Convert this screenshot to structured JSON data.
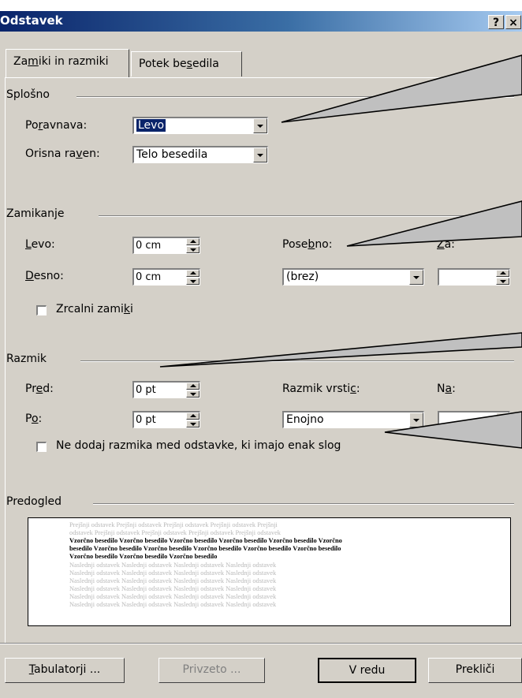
{
  "window": {
    "title": "Odstavek",
    "help_glyph": "?",
    "close_glyph": "×"
  },
  "tabs": [
    {
      "label_pre": "Za",
      "label_acc": "m",
      "label_post": "iki in razmiki",
      "active": true
    },
    {
      "label_pre": "Potek be",
      "label_acc": "s",
      "label_post": "edila",
      "active": false
    }
  ],
  "general": {
    "group": "Splošno",
    "alignment": {
      "pre": "Po",
      "acc": "r",
      "post": "avnava:",
      "value": "Levo"
    },
    "outline": {
      "pre": "Orisna ra",
      "acc": "v",
      "post": "en:",
      "value": "Telo besedila"
    }
  },
  "indent": {
    "group": "Zamikanje",
    "left": {
      "pre": "",
      "acc": "L",
      "post": "evo:",
      "value": "0 cm"
    },
    "right": {
      "pre": "",
      "acc": "D",
      "post": "esno:",
      "value": "0 cm"
    },
    "special": {
      "pre": "Pose",
      "acc": "b",
      "post": "no:",
      "value": "(brez)"
    },
    "by": {
      "pre": "",
      "acc": "Z",
      "post": "a:",
      "value": ""
    },
    "mirror": {
      "pre": "Zrcalni zami",
      "acc": "k",
      "post": "i",
      "checked": false
    }
  },
  "spacing": {
    "group": "Razmik",
    "before": {
      "pre": "Pr",
      "acc": "e",
      "post": "d:",
      "value": "0 pt"
    },
    "after": {
      "pre": "P",
      "acc": "o",
      "post": ":",
      "value": "0 pt"
    },
    "line": {
      "pre": "Razmik vrsti",
      "acc": "c",
      "post": ":",
      "value": "Enojno"
    },
    "at": {
      "pre": "N",
      "acc": "a",
      "post": ":",
      "value": ""
    },
    "no_space": {
      "pre": "Ne doda",
      "acc": "j",
      "post": " razmika med odstavke, ki imajo enak slog",
      "checked": false
    }
  },
  "preview": {
    "group": "Predogled",
    "lines": [
      {
        "style": "grey",
        "text": "Prejšnji odstavek Prejšnji odstavek Prejšnji odstavek Prejšnji odstavek Prejšnji"
      },
      {
        "style": "grey",
        "text": "odstavek Prejšnji odstavek Prejšnji odstavek Prejšnji odstavek Prejšnji odstavek"
      },
      {
        "style": "dark",
        "text": "Vzorčno besedilo Vzorčno besedilo Vzorčno besedilo Vzorčno besedilo Vzorčno besedilo Vzorčno"
      },
      {
        "style": "dark",
        "text": "besedilo Vzorčno besedilo Vzorčno besedilo Vzorčno besedilo Vzorčno besedilo Vzorčno besedilo"
      },
      {
        "style": "dark",
        "text": "Vzorčno besedilo Vzorčno besedilo Vzorčno besedilo"
      },
      {
        "style": "grey",
        "text": "Naslednji odstavek Naslednji odstavek Naslednji odstavek Naslednji odstavek"
      },
      {
        "style": "grey",
        "text": "Naslednji odstavek Naslednji odstavek Naslednji odstavek Naslednji odstavek"
      },
      {
        "style": "grey",
        "text": "Naslednji odstavek Naslednji odstavek Naslednji odstavek Naslednji odstavek"
      },
      {
        "style": "grey",
        "text": "Naslednji odstavek Naslednji odstavek Naslednji odstavek Naslednji odstavek"
      },
      {
        "style": "grey",
        "text": "Naslednji odstavek Naslednji odstavek Naslednji odstavek Naslednji odstavek"
      },
      {
        "style": "grey",
        "text": "Naslednji odstavek Naslednji odstavek Naslednji odstavek Naslednji odstavek"
      }
    ]
  },
  "buttons": {
    "tabs": {
      "pre": "",
      "acc": "T",
      "post": "abulatorji ..."
    },
    "default": "Privzeto ...",
    "ok": "V redu",
    "cancel": "Prekliči"
  },
  "colors": {
    "dialog": "#d4d0c8",
    "title_start": "#0a246a",
    "title_end": "#a6caf0",
    "callout": "#c0c0c0"
  }
}
